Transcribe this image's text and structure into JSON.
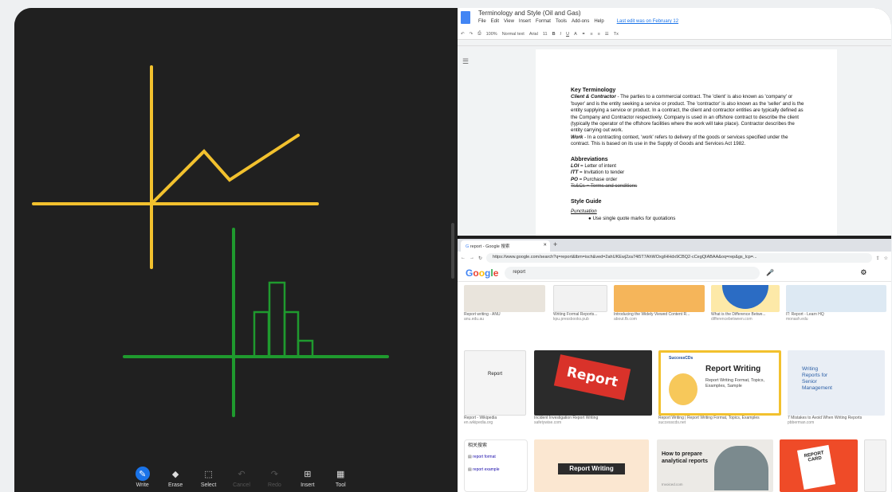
{
  "whiteboard": {
    "toolbar": [
      {
        "label": "Write",
        "icon": "pen-icon",
        "state": "active"
      },
      {
        "label": "Erase",
        "icon": "eraser-icon",
        "state": "normal"
      },
      {
        "label": "Select",
        "icon": "lasso-select-icon",
        "state": "normal"
      },
      {
        "label": "Cancel",
        "icon": "undo-icon",
        "state": "disabled"
      },
      {
        "label": "Redo",
        "icon": "redo-icon",
        "state": "disabled"
      },
      {
        "label": "Insert",
        "icon": "insert-icon",
        "state": "normal"
      },
      {
        "label": "Tool",
        "icon": "tools-grid-icon",
        "state": "normal"
      }
    ],
    "colors": {
      "yellow": "#f2c12e",
      "green": "#1f9a2e",
      "background": "#202020"
    }
  },
  "docs": {
    "title": "Terminology and Style (Oil and Gas)",
    "menu": [
      "File",
      "Edit",
      "View",
      "Insert",
      "Format",
      "Tools",
      "Add-ons",
      "Help"
    ],
    "last_edit": "Last edit was on February 12",
    "toolbar": {
      "zoom": "100%",
      "style": "Normal text",
      "font": "Arial",
      "size": "11"
    },
    "content": {
      "h_key": "Key Terminology",
      "p1_bold": "Client & Contractor",
      "p1": " - The parties to a commercial contract. The 'client' is also known as 'company' or 'buyer' and is the entity seeking a service or product. The 'contractor' is also known as the 'seller' and is the entity supplying a service or product. In a contract, the client and contractor entities are typically defined as the Company and Contractor respectively. Company is used in an offshore contract to describe the client (typically the operator of the offshore facilities where the work will take place). Contractor describes the entity carrying out work.",
      "p2_bold": "Work",
      "p2": " - In a contracting context, 'work' refers to delivery of the goods or services specified under the contract. This is based on its use in the Supply of Goods and Services Act 1982.",
      "h_abbr": "Abbreviations",
      "abbr": [
        {
          "k": "LOI",
          "v": " = Letter of intent"
        },
        {
          "k": "ITT",
          "v": " = Invitation to tender"
        },
        {
          "k": "PO",
          "v": " = Purchase order"
        }
      ],
      "abbr_struck": "Ts&Cs = Terms and conditions",
      "h_style": "Style Guide",
      "punct": "Punctuation",
      "bullet": "Use single quote marks for quotations"
    }
  },
  "browser": {
    "tab": "report - Google 搜索",
    "url": "https://www.google.com/search?q=report&tbm=isch&ved=2ahUKEwj2za74i5T7AhWOxgIHHdx9CBQ2-cCegQIABAA&oq=rep&gs_lcp=...",
    "search": "report",
    "logo": "Google",
    "row1": [
      {
        "cap": "Report writing - ANU",
        "src": "anu.edu.au"
      },
      {
        "cap": "Writing Formal Reports...",
        "src": "kpu.pressbooks.pub"
      },
      {
        "cap": "Introducing the Widely Viewed Content R...",
        "src": "about.fb.com"
      },
      {
        "cap": "What is the Difference Betwe...",
        "src": "differencebetween.com"
      },
      {
        "cap": "IT: Report - Learn HQ",
        "src": "monash.edu"
      }
    ],
    "row2": [
      {
        "cap": "Report - Wikipedia",
        "src": "en.wikipedia.org",
        "img": "Report"
      },
      {
        "cap": "Incident Investigation Report Writing",
        "src": "safetywise.com",
        "img": "Report"
      },
      {
        "cap": "Report Writing | Report Writing Format, Topics, Examples",
        "src": "successcds.net",
        "img": "Report Writing",
        "sub": "Report Writing Format, Topics, Examples, Sample",
        "brand": "SuccessCDs"
      },
      {
        "cap": "7 Mistakes to Avoid When Writing Reports",
        "src": "pbberman.com",
        "img": "Writing Reports for Senior Management"
      }
    ],
    "related_title": "相关搜索",
    "related": [
      "report format",
      "report example"
    ],
    "row3": [
      {
        "img": "Report Writing"
      },
      {
        "img": "How to prepare analytical reports",
        "src": "Invoiced.com"
      },
      {
        "img": "REPORT CARD"
      }
    ]
  }
}
